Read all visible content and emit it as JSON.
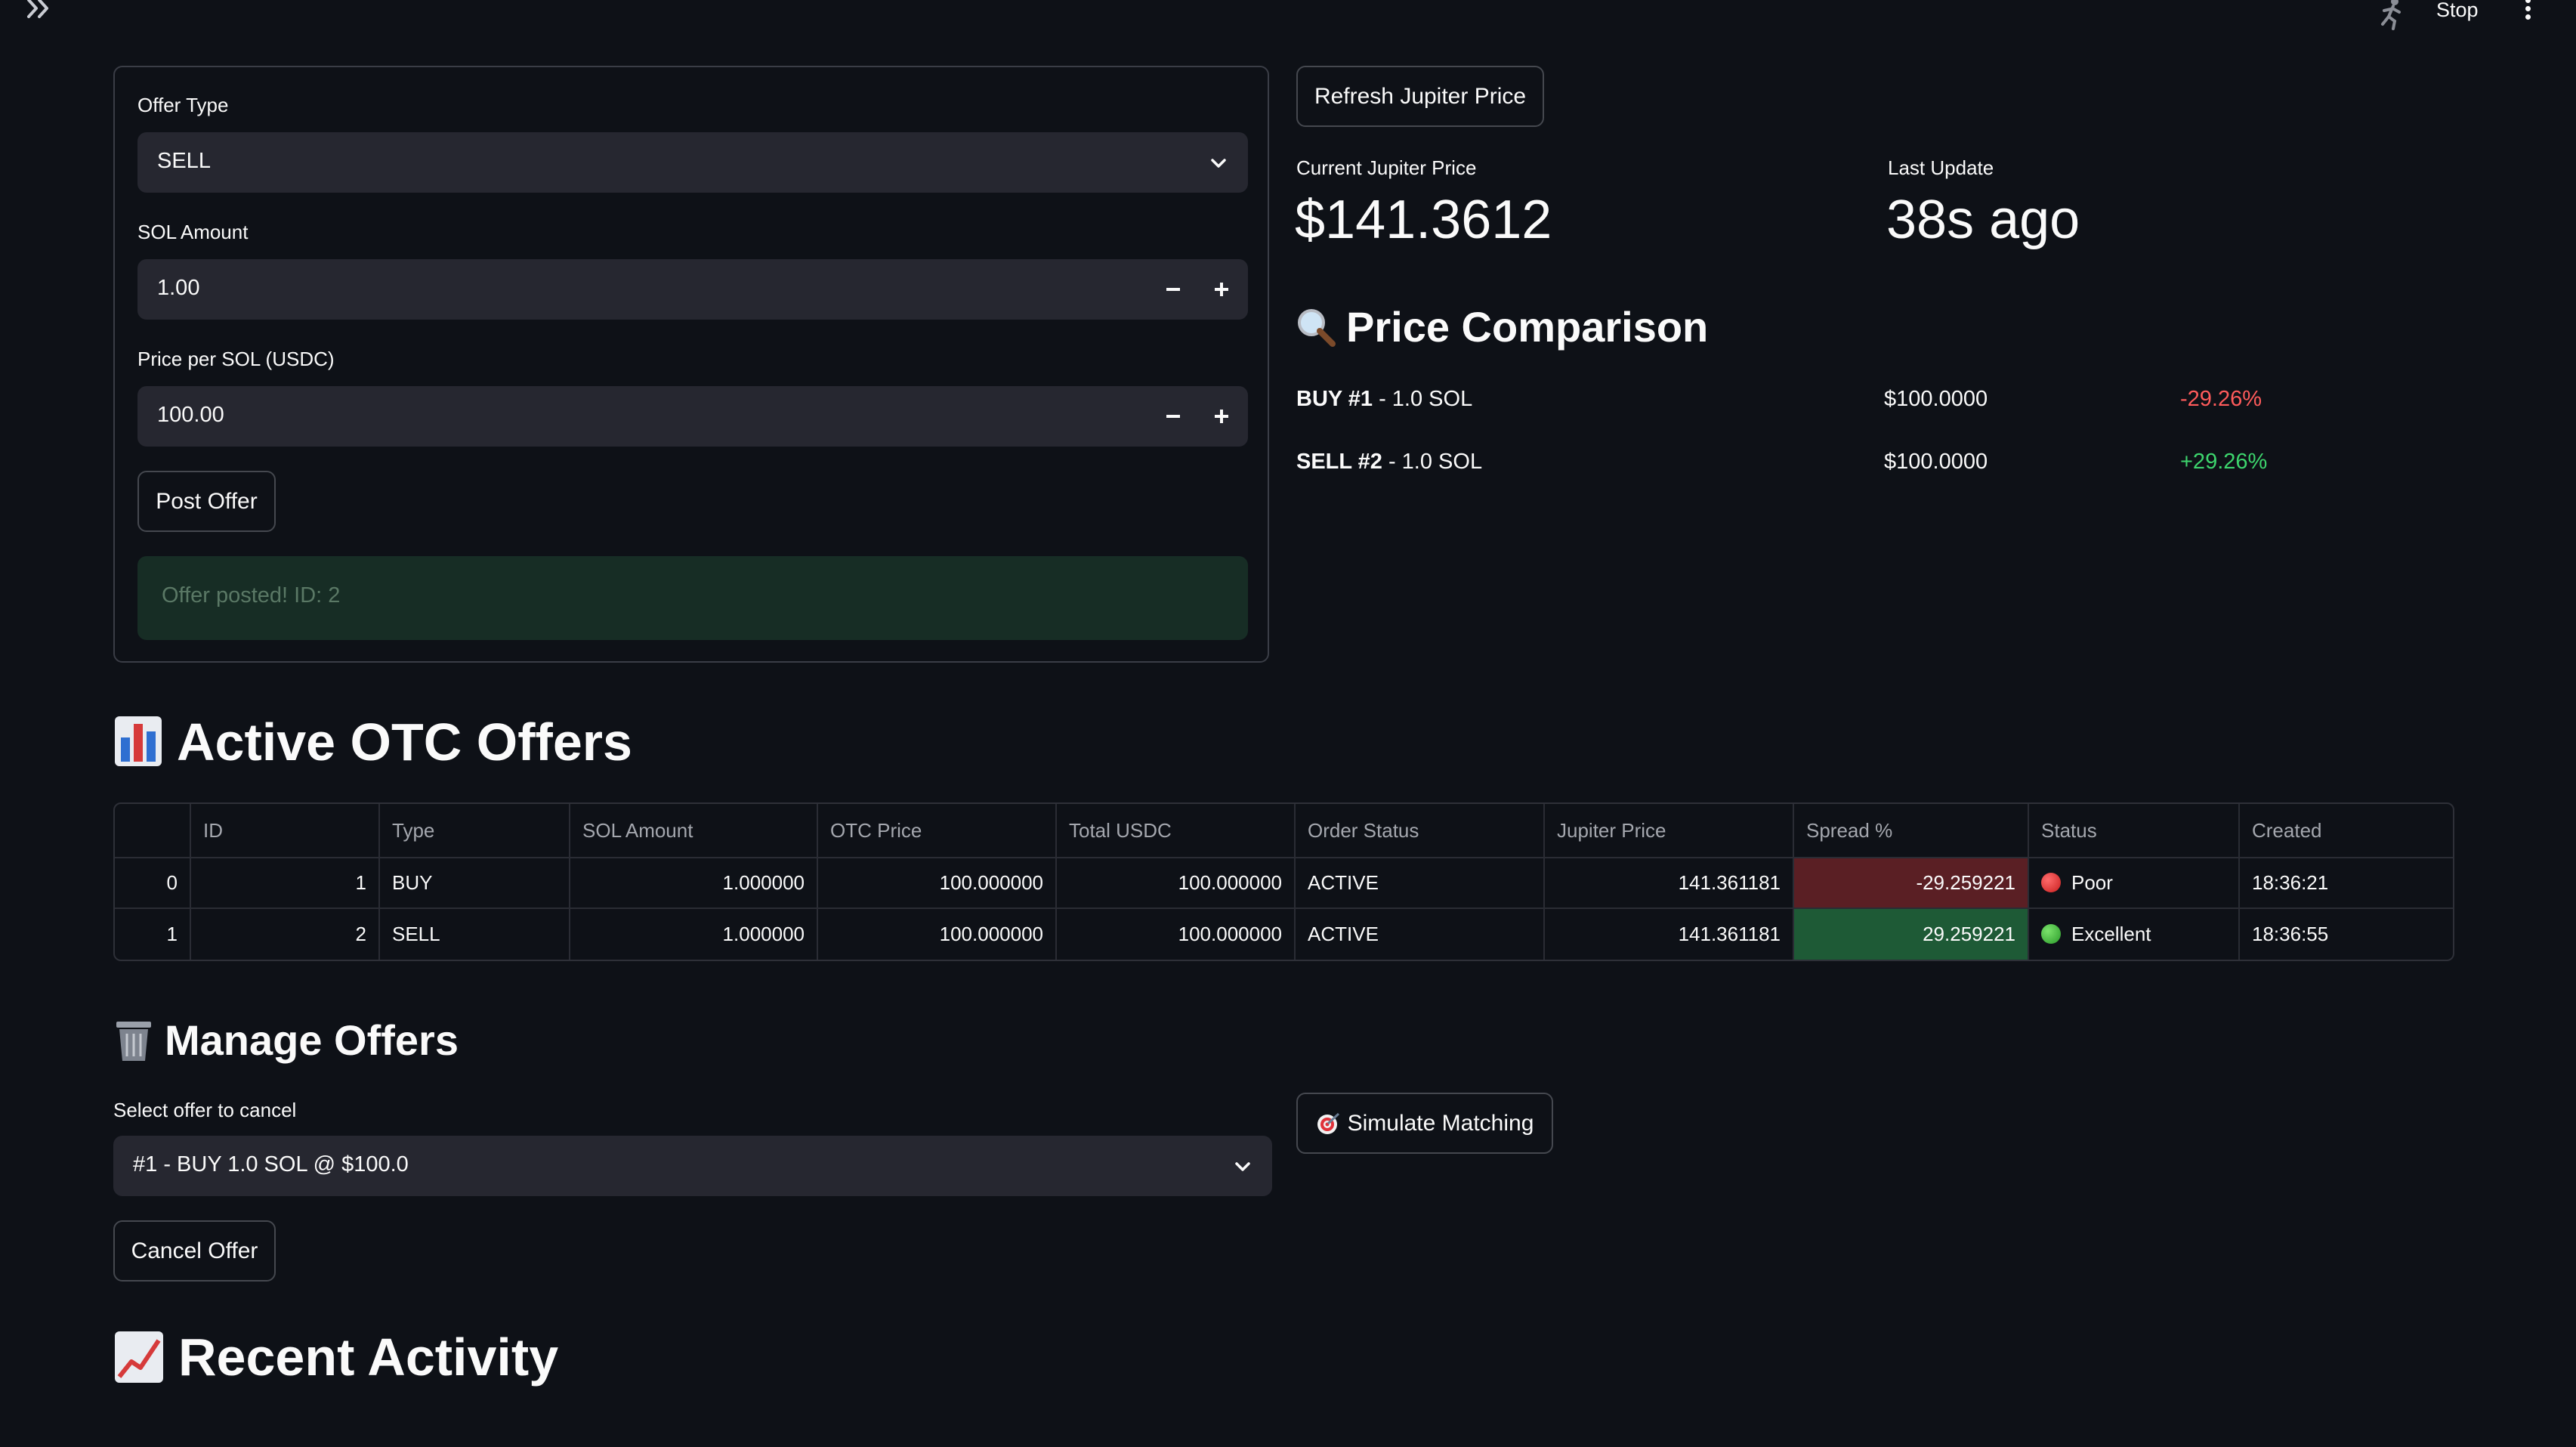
{
  "toolbar": {
    "stop_label": "Stop"
  },
  "form": {
    "offer_type_label": "Offer Type",
    "offer_type_value": "SELL",
    "sol_amount_label": "SOL Amount",
    "sol_amount_value": "1.00",
    "price_label": "Price per SOL (USDC)",
    "price_value": "100.00",
    "post_button": "Post Offer",
    "success_message": "Offer posted! ID: 2"
  },
  "jupiter": {
    "refresh_button": "Refresh Jupiter Price",
    "current_label": "Current Jupiter Price",
    "current_value": "$141.3612",
    "last_update_label": "Last Update",
    "last_update_value": "38s ago"
  },
  "price_comparison": {
    "title": "Price Comparison",
    "rows": [
      {
        "side": "BUY #1",
        "desc": " - 1.0 SOL",
        "price": "$100.0000",
        "delta": "-29.26%"
      },
      {
        "side": "SELL #2",
        "desc": " - 1.0 SOL",
        "price": "$100.0000",
        "delta": "+29.26%"
      }
    ]
  },
  "offers_table": {
    "title": "Active OTC Offers",
    "columns": [
      "",
      "ID",
      "Type",
      "SOL Amount",
      "OTC Price",
      "Total USDC",
      "Order Status",
      "Jupiter Price",
      "Spread %",
      "Status",
      "Created"
    ],
    "rows": [
      [
        "0",
        "1",
        "BUY",
        "1.000000",
        "100.000000",
        "100.000000",
        "ACTIVE",
        "141.361181",
        "-29.259221",
        "Poor",
        "18:36:21"
      ],
      [
        "1",
        "2",
        "SELL",
        "1.000000",
        "100.000000",
        "100.000000",
        "ACTIVE",
        "141.361181",
        "29.259221",
        "Excellent",
        "18:36:55"
      ]
    ]
  },
  "manage": {
    "title": "Manage Offers",
    "select_label": "Select offer to cancel",
    "select_value": "#1 - BUY 1.0 SOL @ $100.0",
    "cancel_button": "Cancel Offer",
    "simulate_button": "Simulate Matching"
  },
  "activity": {
    "title": "Recent Activity"
  },
  "colors": {
    "background": "#0e1117",
    "poor_bg": "#5a1f24",
    "excellent_bg": "#1e5a36",
    "negative": "#ff5b5b",
    "positive": "#3dd56d"
  }
}
